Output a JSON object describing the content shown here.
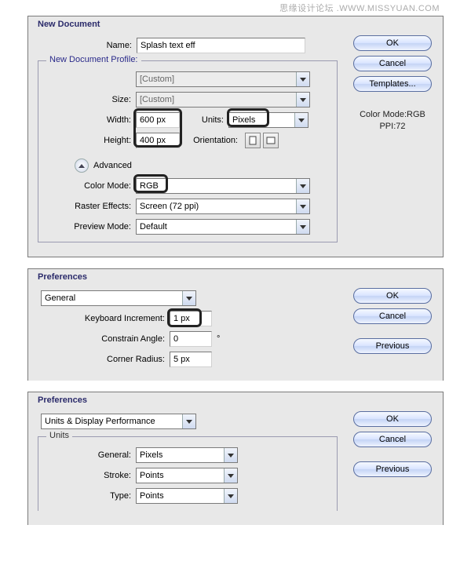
{
  "watermark": "思缘设计论坛  .WWW.MISSYUAN.COM",
  "newdoc": {
    "title": "New Document",
    "name_label": "Name:",
    "name_value": "Splash text eff",
    "profile_legend": "New Document Profile:",
    "profile_value": "[Custom]",
    "size_label": "Size:",
    "size_value": "[Custom]",
    "width_label": "Width:",
    "width_value": "600 px",
    "units_label": "Units:",
    "units_value": "Pixels",
    "height_label": "Height:",
    "height_value": "400 px",
    "orient_label": "Orientation:",
    "advanced_label": "Advanced",
    "colormode_label": "Color Mode:",
    "colormode_value": "RGB",
    "raster_label": "Raster Effects:",
    "raster_value": "Screen (72 ppi)",
    "preview_label": "Preview Mode:",
    "preview_value": "Default",
    "ok": "OK",
    "cancel": "Cancel",
    "templates": "Templates...",
    "side_colormode": "Color Mode:RGB",
    "side_ppi": "PPI:72"
  },
  "prefs1": {
    "title": "Preferences",
    "category": "General",
    "ki_label": "Keyboard Increment:",
    "ki_value": "1 px",
    "ca_label": "Constrain Angle:",
    "ca_value": "0",
    "ca_unit": "°",
    "cr_label": "Corner Radius:",
    "cr_value": "5 px",
    "ok": "OK",
    "cancel": "Cancel",
    "previous": "Previous"
  },
  "prefs2": {
    "title": "Preferences",
    "category": "Units & Display Performance",
    "units_legend": "Units",
    "general_label": "General:",
    "general_value": "Pixels",
    "stroke_label": "Stroke:",
    "stroke_value": "Points",
    "type_label": "Type:",
    "type_value": "Points",
    "ok": "OK",
    "cancel": "Cancel",
    "previous": "Previous"
  }
}
